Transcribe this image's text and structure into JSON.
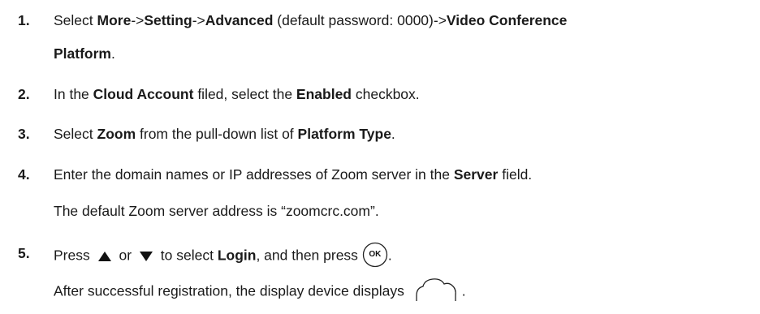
{
  "steps": [
    {
      "number": "1.",
      "t1": "Select ",
      "b1": "More",
      "t2": "->",
      "b2": "Setting",
      "t3": "->",
      "b3": "Advanced",
      "t4": " (default password: 0000)->",
      "b4": "Video Conference",
      "b5": "Platform",
      "t5": "."
    },
    {
      "number": "2.",
      "t1": "In the ",
      "b1": "Cloud Account",
      "t2": " filed, select the ",
      "b2": "Enabled",
      "t3": " checkbox."
    },
    {
      "number": "3.",
      "t1": "Select ",
      "b1": "Zoom",
      "t2": " from the pull-down list of ",
      "b2": "Platform Type",
      "t3": "."
    },
    {
      "number": "4.",
      "t1": "Enter the domain names or IP addresses of Zoom server in the ",
      "b1": "Server",
      "t2": " field.",
      "note": "The default Zoom server address is “zoomcrc.com”."
    },
    {
      "number": "5.",
      "t1": "Press ",
      "t2": " or ",
      "t3": " to select ",
      "b1": "Login",
      "t4": ", and then press ",
      "ok_label": "OK",
      "t5": ".",
      "note": "After successful registration, the display device displays ",
      "note_end": "."
    }
  ]
}
